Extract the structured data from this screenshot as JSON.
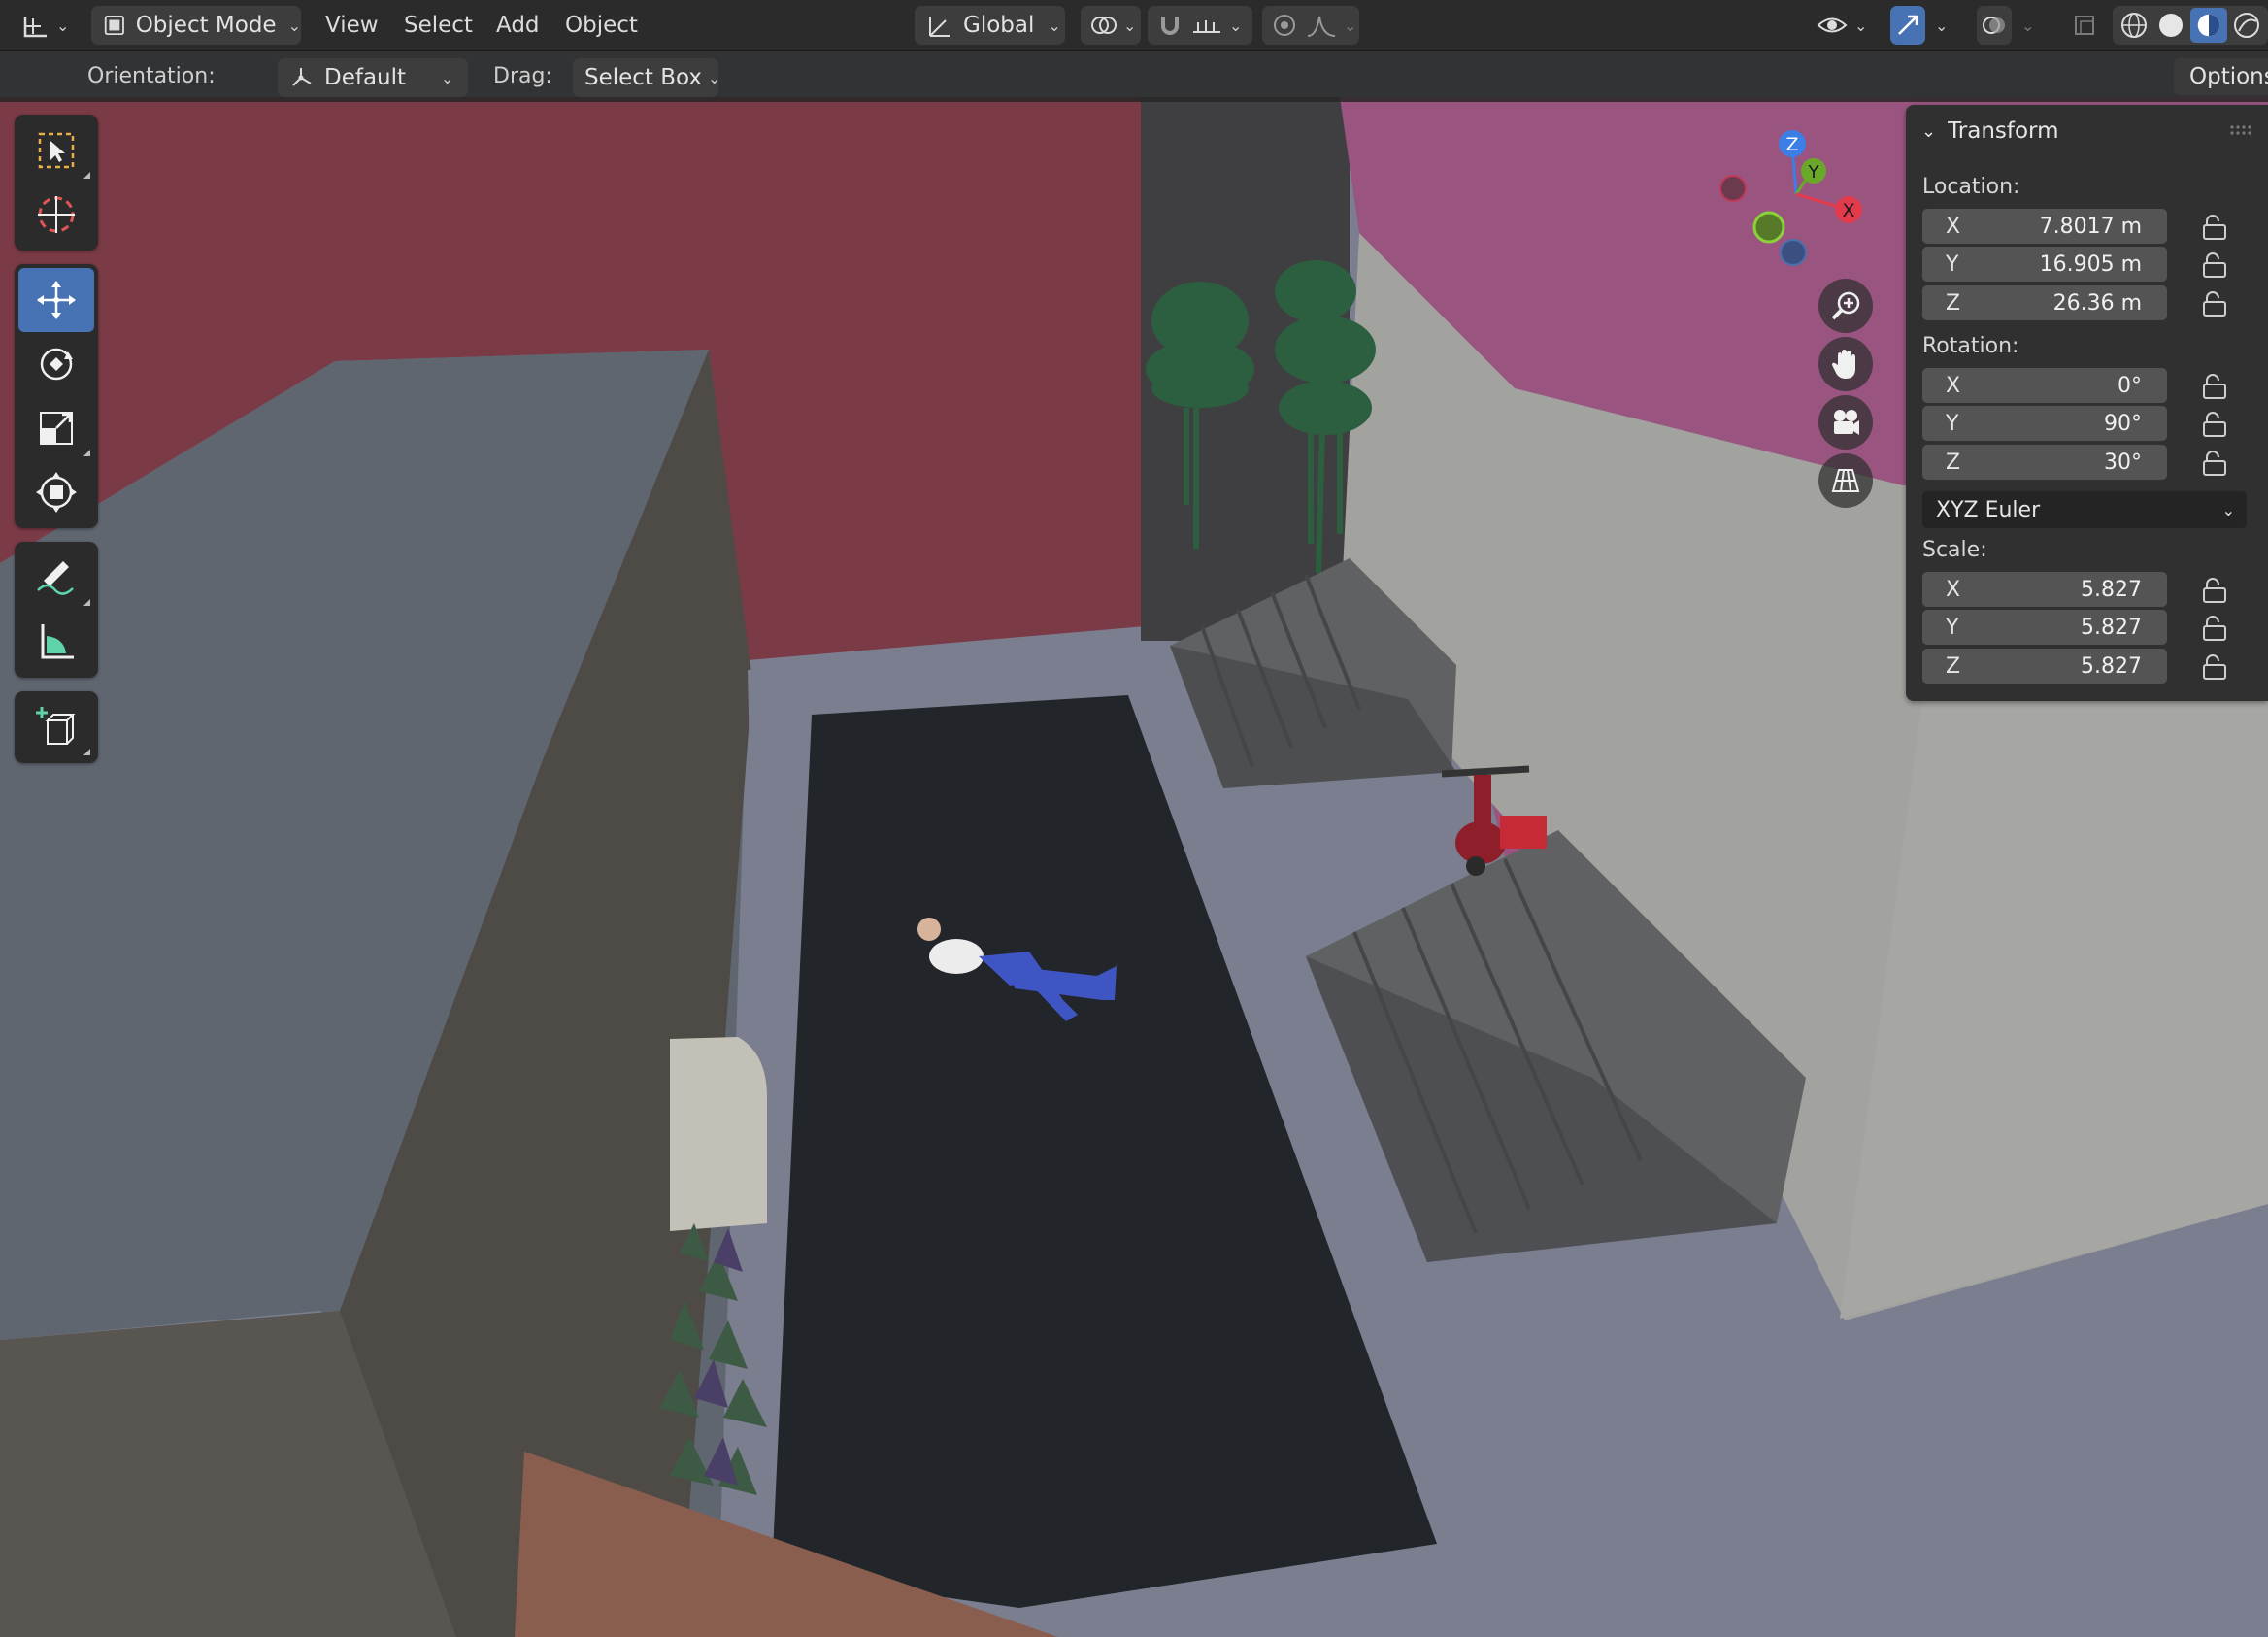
{
  "header": {
    "editor_type_icon": "grid-axis-icon",
    "mode": "Object Mode",
    "menus": [
      "View",
      "Select",
      "Add",
      "Object"
    ],
    "transform_orientation": "Global"
  },
  "tool_settings": {
    "orientation_label": "Orientation:",
    "orientation_value": "Default",
    "drag_label": "Drag:",
    "drag_value": "Select Box",
    "options_label": "Options"
  },
  "toolbar": {
    "tools": [
      "select-box",
      "cursor",
      "move",
      "rotate",
      "scale",
      "transform",
      "annotate",
      "measure",
      "add-cube"
    ],
    "active_tool": "move"
  },
  "gizmo": {
    "x": "X",
    "y": "Y",
    "z": "Z"
  },
  "transform_panel": {
    "title": "Transform",
    "location_label": "Location:",
    "location": [
      {
        "axis": "X",
        "value": "7.8017 m"
      },
      {
        "axis": "Y",
        "value": "16.905 m"
      },
      {
        "axis": "Z",
        "value": "26.36 m"
      }
    ],
    "rotation_label": "Rotation:",
    "rotation": [
      {
        "axis": "X",
        "value": "0°"
      },
      {
        "axis": "Y",
        "value": "90°"
      },
      {
        "axis": "Z",
        "value": "30°"
      }
    ],
    "rotation_mode": "XYZ Euler",
    "scale_label": "Scale:",
    "scale": [
      {
        "axis": "X",
        "value": "5.827"
      },
      {
        "axis": "Y",
        "value": "5.827"
      },
      {
        "axis": "Z",
        "value": "5.827"
      }
    ]
  },
  "colors": {
    "accent": "#4772b3",
    "header_bg": "#2b2b2b",
    "panel_bg": "#303030"
  }
}
